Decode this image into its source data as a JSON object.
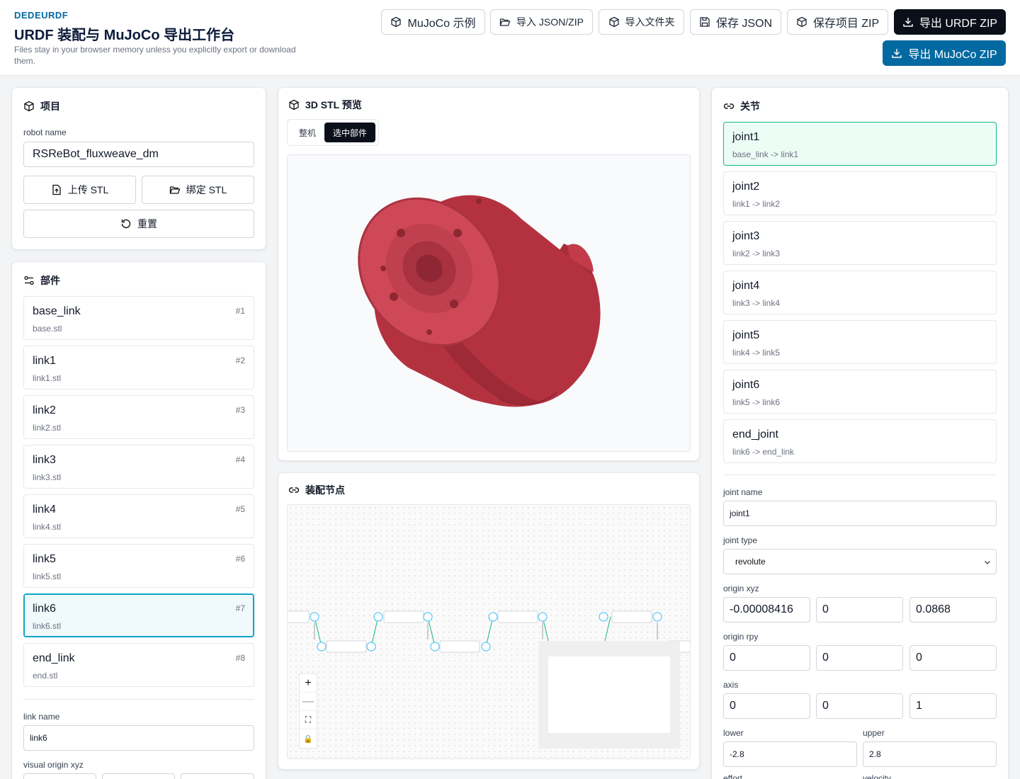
{
  "header": {
    "brand": "DEDEURDF",
    "title": "URDF 装配与 MuJoCo 导出工作台",
    "subtitle": "Files stay in your browser memory unless you explicitly export or download them.",
    "buttons": {
      "mujoco_example": "MuJoCo 示例",
      "import_json_zip": "导入 JSON/ZIP",
      "import_folder": "导入文件夹",
      "save_json": "保存 JSON",
      "save_project_zip": "保存项目 ZIP",
      "export_urdf_zip": "导出 URDF ZIP",
      "export_mujoco_zip": "导出 MuJoCo ZIP"
    }
  },
  "project": {
    "title": "项目",
    "robot_name_label": "robot name",
    "robot_name": "RSReBot_fluxweave_dm",
    "upload_stl": "上传 STL",
    "bind_stl": "绑定 STL",
    "reset": "重置"
  },
  "parts": {
    "title": "部件",
    "items": [
      {
        "name": "base_link",
        "file": "base.stl",
        "index": "#1"
      },
      {
        "name": "link1",
        "file": "link1.stl",
        "index": "#2"
      },
      {
        "name": "link2",
        "file": "link2.stl",
        "index": "#3"
      },
      {
        "name": "link3",
        "file": "link3.stl",
        "index": "#4"
      },
      {
        "name": "link4",
        "file": "link4.stl",
        "index": "#5"
      },
      {
        "name": "link5",
        "file": "link5.stl",
        "index": "#6"
      },
      {
        "name": "link6",
        "file": "link6.stl",
        "index": "#7"
      },
      {
        "name": "end_link",
        "file": "end.stl",
        "index": "#8"
      }
    ],
    "selected_index": 6,
    "link_name_label": "link name",
    "link_name": "link6",
    "visual_origin_label": "visual origin xyz"
  },
  "preview": {
    "title": "3D STL 预览",
    "tab_whole": "整机",
    "tab_selected": "选中部件",
    "active_tab": "selected",
    "model_color": "#c23b4a"
  },
  "assembly": {
    "title": "装配节点",
    "zoom_in": "+",
    "zoom_out": "—",
    "fit": "⛶",
    "lock": "🔒"
  },
  "joints": {
    "title": "关节",
    "items": [
      {
        "name": "joint1",
        "rel": "base_link -> link1"
      },
      {
        "name": "joint2",
        "rel": "link1 -> link2"
      },
      {
        "name": "joint3",
        "rel": "link2 -> link3"
      },
      {
        "name": "joint4",
        "rel": "link3 -> link4"
      },
      {
        "name": "joint5",
        "rel": "link4 -> link5"
      },
      {
        "name": "joint6",
        "rel": "link5 -> link6"
      },
      {
        "name": "end_joint",
        "rel": "link6 -> end_link"
      }
    ],
    "selected_index": 0,
    "form": {
      "joint_name_label": "joint name",
      "joint_name": "joint1",
      "joint_type_label": "joint type",
      "joint_type": "revolute",
      "origin_xyz_label": "origin xyz",
      "origin_xyz": [
        "-0.00008416",
        "0",
        "0.0868"
      ],
      "origin_rpy_label": "origin rpy",
      "origin_rpy": [
        "0",
        "0",
        "0"
      ],
      "axis_label": "axis",
      "axis": [
        "0",
        "0",
        "1"
      ],
      "lower_label": "lower",
      "lower": "-2.8",
      "upper_label": "upper",
      "upper": "2.8",
      "effort_label": "effort",
      "velocity_label": "velocity"
    }
  },
  "colors": {
    "accent_blue": "#0369a1",
    "dark_button": "#0b0f19",
    "part_selected": "#0ea5c6",
    "joint_selected": "#10b981"
  }
}
